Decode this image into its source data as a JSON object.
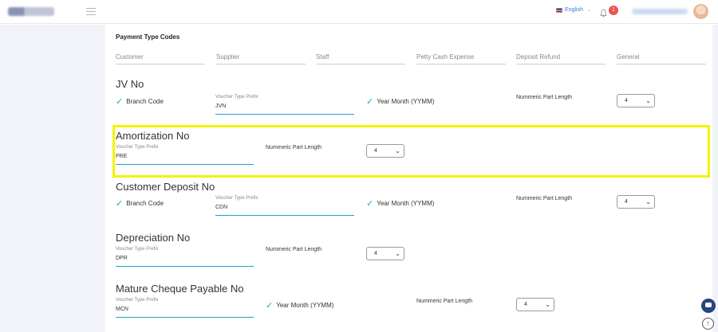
{
  "header": {
    "language": "English",
    "notification_count": "1"
  },
  "payment_type_codes": {
    "title": "Payment Type Codes",
    "fields": [
      "Customer",
      "Supplier",
      "Staff",
      "Petty Cash Expense",
      "Deposit Refund",
      "General"
    ]
  },
  "labels": {
    "voucher_type_prefix": "Voucher Type Prefix",
    "branch_code": "Branch Code",
    "year_month": "Year Month (YYMM)",
    "numeric_part_length": "Nummeric Part Length"
  },
  "sections": {
    "jv": {
      "title": "JV No",
      "prefix": "JVN",
      "length": "4"
    },
    "amortization": {
      "title": "Amortization No",
      "prefix": "PRE",
      "length": "4"
    },
    "customer_deposit": {
      "title": "Customer Deposit No",
      "prefix": "CDN",
      "length": "4"
    },
    "depreciation": {
      "title": "Depreciation No",
      "prefix": "DPR",
      "length": "4"
    },
    "mature_cheque": {
      "title": "Mature Cheque Payable No",
      "prefix": "MCN",
      "length": "4"
    }
  },
  "icons": {
    "menu": "hamburger-icon",
    "bell": "bell-icon",
    "check": "checkmark-icon",
    "chat": "chat-icon",
    "scroll_top": "arrow-up-icon"
  },
  "colors": {
    "accent": "#1ea1c7",
    "highlight": "#f3f300",
    "badge": "#e8554e",
    "chat_button": "#27457e"
  }
}
